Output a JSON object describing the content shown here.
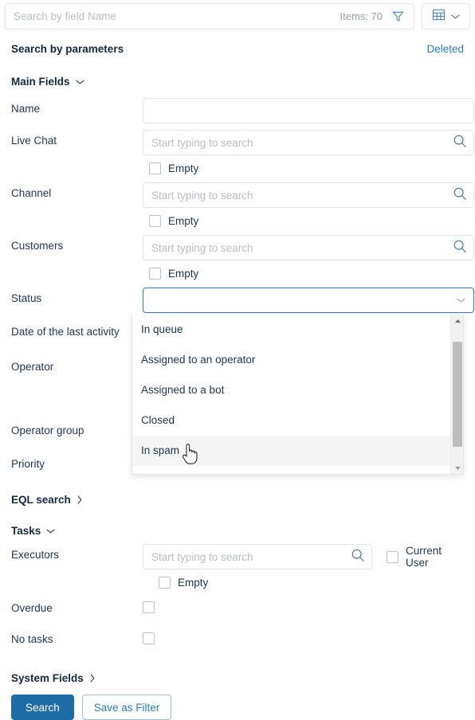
{
  "topbar": {
    "search_placeholder": "Search by field Name",
    "search_value": "",
    "items_count": "Items: 70",
    "filter_icon": "funnel-icon",
    "view_icon": "table-icon",
    "view_chevron_icon": "chevron-down-icon"
  },
  "panel": {
    "title": "Search by parameters",
    "deleted_link": "Deleted"
  },
  "sections": {
    "main_fields": "Main Fields",
    "eql_search": "EQL search",
    "tasks": "Tasks",
    "system_fields": "System Fields"
  },
  "placeholders": {
    "start_typing": "Start typing to search"
  },
  "labels": {
    "name": "Name",
    "live_chat": "Live Chat",
    "channel": "Channel",
    "customers": "Customers",
    "status": "Status",
    "date_last_activity": "Date of the last activity",
    "operator": "Operator",
    "operator_group": "Operator group",
    "priority": "Priority",
    "executors": "Executors",
    "overdue": "Overdue",
    "no_tasks": "No tasks",
    "empty": "Empty",
    "current_user": "Current User"
  },
  "values": {
    "name": "",
    "live_chat": "",
    "channel": "",
    "customers": "",
    "status": "",
    "executors": ""
  },
  "status_dropdown": {
    "open": true,
    "highlighted": "In spam",
    "options": [
      "In queue",
      "Assigned to an operator",
      "Assigned to a bot",
      "Closed",
      "In spam"
    ]
  },
  "footer": {
    "search_button": "Search",
    "save_filter_button": "Save as Filter"
  },
  "colors": {
    "accent": "#1f6ba5",
    "link": "#2e79b9",
    "focus_border": "#2e79b9",
    "text": "#1f3550",
    "placeholder": "#b9bdc3"
  }
}
